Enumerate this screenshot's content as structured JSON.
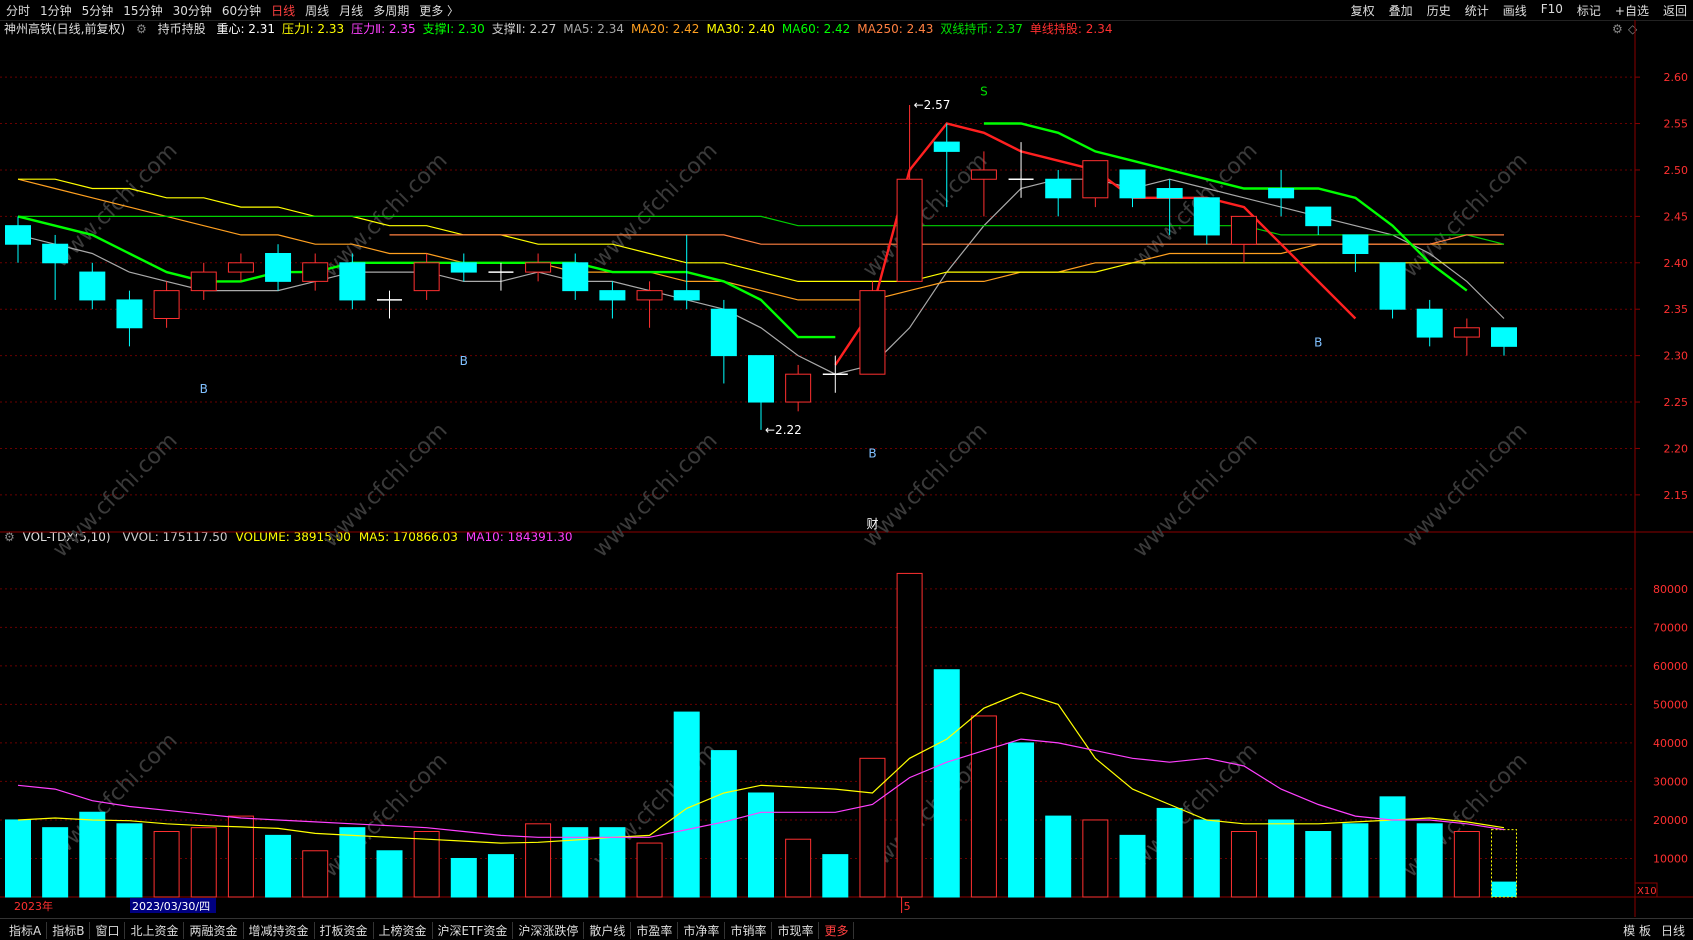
{
  "topbar": {
    "periods": [
      "分时",
      "1分钟",
      "5分钟",
      "15分钟",
      "30分钟",
      "60分钟",
      "日线",
      "周线",
      "月线",
      "多周期",
      "更多 〉"
    ],
    "active_period": "日线",
    "tools": [
      "复权",
      "叠加",
      "历史",
      "统计",
      "画线",
      "F10",
      "标记",
      "+自选",
      "返回"
    ]
  },
  "info": {
    "name": "神州高铁(日线,前复权)",
    "indicator": "持币持股",
    "items": [
      {
        "text": "重心: 2.31",
        "color": "#ffffff"
      },
      {
        "text": "压力Ⅰ: 2.33",
        "color": "#ffff00"
      },
      {
        "text": "压力Ⅱ: 2.35",
        "color": "#ff40ff"
      },
      {
        "text": "支撑Ⅰ: 2.30",
        "color": "#00ff00"
      },
      {
        "text": "支撑Ⅱ: 2.27",
        "color": "#cccccc"
      },
      {
        "text": "MA5: 2.34",
        "color": "#aaaaaa"
      },
      {
        "text": "MA20: 2.42",
        "color": "#ffa020"
      },
      {
        "text": "MA30: 2.40",
        "color": "#ffff00"
      },
      {
        "text": "MA60: 2.42",
        "color": "#00ff00"
      },
      {
        "text": "MA250: 2.43",
        "color": "#ff8040"
      },
      {
        "text": "双线持币: 2.37",
        "color": "#00e000"
      },
      {
        "text": "单线持股: 2.34",
        "color": "#ff3030"
      }
    ]
  },
  "volinfo": {
    "name": "VOL-TDX(5,10)",
    "items": [
      {
        "text": "VVOL: 175117.50",
        "color": "#cccccc"
      },
      {
        "text": "VOLUME: 38915.00",
        "color": "#ffff00"
      },
      {
        "text": "MA5: 170866.03",
        "color": "#ffff00"
      },
      {
        "text": "MA10: 184391.30",
        "color": "#ff40ff"
      }
    ]
  },
  "bottombar": {
    "tabs": [
      "指标A",
      "指标B",
      "窗口",
      "北上资金",
      "两融资金",
      "增减持资金",
      "打板资金",
      "上榜资金",
      "沪深ETF资金",
      "沪深涨跌停",
      "散户线",
      "市盈率",
      "市净率",
      "市销率",
      "市现率",
      "更多"
    ],
    "right": [
      "模 板",
      "日线"
    ]
  },
  "axis_labels": {
    "year": "2023年",
    "date_box": "2023/03/30/四",
    "month_mark": "5",
    "vol_unit": "X10",
    "cai_mark": "财",
    "watermark": "www.cfchi.com"
  },
  "colors": {
    "up": "#ff3030",
    "down": "#00ffff",
    "doji": "#ffffff",
    "grid": "#6a0000"
  },
  "chart_data": [
    {
      "type": "candlestick",
      "y_ticks": [
        2.15,
        2.2,
        2.25,
        2.3,
        2.35,
        2.4,
        2.45,
        2.5,
        2.55,
        2.6
      ],
      "ylim": [
        2.11,
        2.64
      ],
      "candles": [
        {
          "o": 2.44,
          "c": 2.42,
          "h": 2.45,
          "l": 2.4
        },
        {
          "o": 2.42,
          "c": 2.4,
          "h": 2.43,
          "l": 2.36
        },
        {
          "o": 2.39,
          "c": 2.36,
          "h": 2.4,
          "l": 2.35
        },
        {
          "o": 2.36,
          "c": 2.33,
          "h": 2.37,
          "l": 2.31
        },
        {
          "o": 2.34,
          "c": 2.37,
          "h": 2.38,
          "l": 2.33
        },
        {
          "o": 2.37,
          "c": 2.39,
          "h": 2.4,
          "l": 2.36
        },
        {
          "o": 2.39,
          "c": 2.4,
          "h": 2.41,
          "l": 2.38
        },
        {
          "o": 2.41,
          "c": 2.38,
          "h": 2.42,
          "l": 2.37
        },
        {
          "o": 2.38,
          "c": 2.4,
          "h": 2.41,
          "l": 2.37
        },
        {
          "o": 2.4,
          "c": 2.36,
          "h": 2.41,
          "l": 2.35
        },
        {
          "o": 2.36,
          "c": 2.36,
          "h": 2.37,
          "l": 2.34
        },
        {
          "o": 2.37,
          "c": 2.4,
          "h": 2.41,
          "l": 2.36
        },
        {
          "o": 2.4,
          "c": 2.39,
          "h": 2.41,
          "l": 2.38
        },
        {
          "o": 2.39,
          "c": 2.39,
          "h": 2.4,
          "l": 2.37
        },
        {
          "o": 2.39,
          "c": 2.4,
          "h": 2.41,
          "l": 2.38
        },
        {
          "o": 2.4,
          "c": 2.37,
          "h": 2.41,
          "l": 2.36
        },
        {
          "o": 2.37,
          "c": 2.36,
          "h": 2.38,
          "l": 2.34
        },
        {
          "o": 2.36,
          "c": 2.37,
          "h": 2.38,
          "l": 2.33
        },
        {
          "o": 2.37,
          "c": 2.36,
          "h": 2.43,
          "l": 2.35
        },
        {
          "o": 2.35,
          "c": 2.3,
          "h": 2.36,
          "l": 2.27
        },
        {
          "o": 2.3,
          "c": 2.25,
          "h": 2.3,
          "l": 2.22
        },
        {
          "o": 2.25,
          "c": 2.28,
          "h": 2.29,
          "l": 2.24
        },
        {
          "o": 2.28,
          "c": 2.28,
          "h": 2.3,
          "l": 2.26
        },
        {
          "o": 2.28,
          "c": 2.37,
          "h": 2.38,
          "l": 2.28
        },
        {
          "o": 2.38,
          "c": 2.49,
          "h": 2.57,
          "l": 2.38
        },
        {
          "o": 2.53,
          "c": 2.52,
          "h": 2.55,
          "l": 2.46
        },
        {
          "o": 2.49,
          "c": 2.5,
          "h": 2.52,
          "l": 2.45
        },
        {
          "o": 2.49,
          "c": 2.49,
          "h": 2.53,
          "l": 2.47
        },
        {
          "o": 2.49,
          "c": 2.47,
          "h": 2.5,
          "l": 2.45
        },
        {
          "o": 2.47,
          "c": 2.51,
          "h": 2.51,
          "l": 2.46
        },
        {
          "o": 2.5,
          "c": 2.47,
          "h": 2.5,
          "l": 2.46
        },
        {
          "o": 2.48,
          "c": 2.47,
          "h": 2.49,
          "l": 2.43
        },
        {
          "o": 2.47,
          "c": 2.43,
          "h": 2.47,
          "l": 2.42
        },
        {
          "o": 2.42,
          "c": 2.45,
          "h": 2.45,
          "l": 2.4
        },
        {
          "o": 2.48,
          "c": 2.47,
          "h": 2.5,
          "l": 2.45
        },
        {
          "o": 2.46,
          "c": 2.44,
          "h": 2.46,
          "l": 2.43
        },
        {
          "o": 2.43,
          "c": 2.41,
          "h": 2.43,
          "l": 2.39
        },
        {
          "o": 2.4,
          "c": 2.35,
          "h": 2.4,
          "l": 2.34
        },
        {
          "o": 2.35,
          "c": 2.32,
          "h": 2.36,
          "l": 2.31
        },
        {
          "o": 2.32,
          "c": 2.33,
          "h": 2.34,
          "l": 2.3
        },
        {
          "o": 2.33,
          "c": 2.31,
          "h": 2.33,
          "l": 2.3
        }
      ],
      "series": [
        {
          "name": "MA5",
          "color": "#aaaaaa",
          "values": [
            2.43,
            2.42,
            2.41,
            2.39,
            2.38,
            2.37,
            2.37,
            2.37,
            2.38,
            2.39,
            2.39,
            2.39,
            2.38,
            2.38,
            2.39,
            2.38,
            2.38,
            2.37,
            2.36,
            2.35,
            2.33,
            2.3,
            2.28,
            2.29,
            2.33,
            2.39,
            2.44,
            2.48,
            2.49,
            2.49,
            2.48,
            2.49,
            2.48,
            2.47,
            2.46,
            2.45,
            2.44,
            2.43,
            2.41,
            2.38,
            2.34
          ]
        },
        {
          "name": "MA20",
          "color": "#ffa020",
          "values": [
            2.49,
            2.48,
            2.47,
            2.46,
            2.45,
            2.44,
            2.43,
            2.43,
            2.42,
            2.42,
            2.41,
            2.41,
            2.4,
            2.4,
            2.4,
            2.39,
            2.39,
            2.39,
            2.38,
            2.38,
            2.37,
            2.36,
            2.36,
            2.36,
            2.37,
            2.38,
            2.38,
            2.39,
            2.39,
            2.4,
            2.4,
            2.41,
            2.41,
            2.41,
            2.41,
            2.42,
            2.42,
            2.42,
            2.42,
            2.42,
            2.42
          ]
        },
        {
          "name": "MA30",
          "color": "#ffff00",
          "values": [
            2.49,
            2.49,
            2.48,
            2.48,
            2.47,
            2.47,
            2.46,
            2.46,
            2.45,
            2.45,
            2.44,
            2.44,
            2.43,
            2.43,
            2.42,
            2.42,
            2.42,
            2.41,
            2.4,
            2.4,
            2.39,
            2.38,
            2.38,
            2.38,
            2.38,
            2.39,
            2.39,
            2.39,
            2.39,
            2.39,
            2.4,
            2.4,
            2.4,
            2.4,
            2.4,
            2.4,
            2.4,
            2.4,
            2.4,
            2.4,
            2.4
          ]
        },
        {
          "name": "MA60",
          "color": "#00d000",
          "values": [
            2.45,
            2.45,
            2.45,
            2.45,
            2.45,
            2.45,
            2.45,
            2.45,
            2.45,
            2.45,
            2.45,
            2.45,
            2.45,
            2.45,
            2.45,
            2.45,
            2.45,
            2.45,
            2.45,
            2.45,
            2.45,
            2.44,
            2.44,
            2.44,
            2.44,
            2.44,
            2.44,
            2.44,
            2.44,
            2.44,
            2.44,
            2.44,
            2.44,
            2.44,
            2.43,
            2.43,
            2.43,
            2.43,
            2.43,
            2.43,
            2.42
          ]
        },
        {
          "name": "MA250",
          "color": "#ff8040",
          "values": [
            null,
            null,
            null,
            null,
            null,
            null,
            null,
            null,
            null,
            null,
            2.43,
            2.43,
            2.43,
            2.43,
            2.43,
            2.43,
            2.43,
            2.43,
            2.43,
            2.43,
            2.42,
            2.42,
            2.42,
            2.42,
            2.42,
            2.42,
            2.42,
            2.42,
            2.42,
            2.42,
            2.42,
            2.42,
            2.42,
            2.42,
            2.42,
            2.42,
            2.42,
            2.42,
            2.42,
            2.43,
            2.43
          ]
        },
        {
          "name": "双线持币",
          "color": "#00ff00",
          "values": [
            2.45,
            2.44,
            2.43,
            2.41,
            2.39,
            2.38,
            2.38,
            2.39,
            2.39,
            2.4,
            2.4,
            2.4,
            2.4,
            2.4,
            2.4,
            2.4,
            2.39,
            2.39,
            2.39,
            2.38,
            2.36,
            2.32,
            2.32,
            null,
            null,
            null,
            2.55,
            2.55,
            2.54,
            2.52,
            2.51,
            2.5,
            2.49,
            2.48,
            2.48,
            2.48,
            2.47,
            2.44,
            2.4,
            2.37,
            null
          ]
        },
        {
          "name": "单线持股",
          "color": "#ff2020",
          "values": [
            null,
            null,
            null,
            null,
            null,
            null,
            null,
            null,
            null,
            null,
            null,
            null,
            null,
            null,
            null,
            null,
            null,
            null,
            null,
            null,
            null,
            null,
            2.29,
            2.35,
            2.5,
            2.55,
            2.54,
            2.52,
            2.51,
            2.5,
            2.47,
            2.47,
            2.47,
            2.46,
            2.42,
            2.38,
            2.34,
            null,
            null,
            null,
            null
          ]
        }
      ],
      "annotations": [
        {
          "text": "2.57",
          "x_index": 24,
          "price": 2.57
        },
        {
          "text": "2.22",
          "x_index": 20,
          "price": 2.22
        },
        {
          "text": "B",
          "x_index": 5,
          "price": 2.26
        },
        {
          "text": "B",
          "x_index": 12,
          "price": 2.29
        },
        {
          "text": "B",
          "x_index": 23,
          "price": 2.19
        },
        {
          "text": "B",
          "x_index": 35,
          "price": 2.31
        },
        {
          "text": "S",
          "x_index": 26,
          "price": 2.58
        }
      ]
    },
    {
      "type": "bar",
      "y_ticks": [
        10000,
        20000,
        30000,
        40000,
        50000,
        60000,
        70000,
        80000
      ],
      "ylim": [
        0,
        88000
      ],
      "values": [
        20000,
        18000,
        22000,
        19000,
        17000,
        18000,
        21000,
        16000,
        12000,
        18000,
        12000,
        17000,
        10000,
        11000,
        19000,
        18000,
        18000,
        14000,
        48000,
        38000,
        27000,
        15000,
        11000,
        36000,
        84000,
        59000,
        47000,
        40000,
        21000,
        20000,
        16000,
        23000,
        20000,
        17000,
        20000,
        17000,
        19000,
        26000,
        19000,
        17000,
        4000
      ],
      "series": [
        {
          "name": "MA5",
          "color": "#ffff00",
          "values": [
            20000,
            20500,
            20000,
            19800,
            19000,
            18500,
            18200,
            17800,
            16500,
            16000,
            15500,
            15000,
            14500,
            14000,
            14200,
            14800,
            15500,
            16000,
            23000,
            27000,
            29000,
            28500,
            28000,
            27000,
            36000,
            41000,
            49000,
            53000,
            50000,
            36000,
            28000,
            24000,
            20000,
            19000,
            19000,
            19000,
            19500,
            20000,
            20500,
            19500,
            18000
          ]
        },
        {
          "name": "MA10",
          "color": "#ff40ff",
          "values": [
            29000,
            28000,
            25000,
            23500,
            22500,
            21500,
            20500,
            20000,
            19500,
            19000,
            18500,
            18000,
            17000,
            16000,
            15500,
            15500,
            15500,
            15500,
            17500,
            19500,
            22000,
            22000,
            22000,
            24000,
            31000,
            35000,
            38000,
            41000,
            40000,
            38000,
            36000,
            35000,
            36000,
            34000,
            28000,
            24000,
            21000,
            20000,
            20000,
            19000,
            17500
          ]
        }
      ]
    }
  ]
}
